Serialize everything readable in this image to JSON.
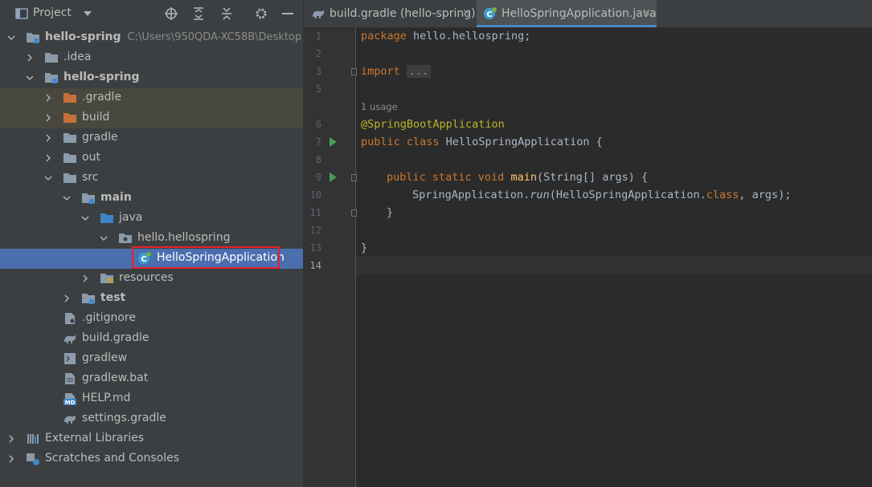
{
  "project_panel": {
    "title": "Project",
    "tree": [
      {
        "label": "hello-spring",
        "path": "C:\\Users\\950QDA-XC58B\\Desktop",
        "expanded": true,
        "bold": true,
        "icon": "module-folder-icon"
      },
      {
        "label": ".idea",
        "expanded": false,
        "icon": "folder-icon"
      },
      {
        "label": "hello-spring",
        "expanded": true,
        "bold": true,
        "icon": "module-folder-icon"
      },
      {
        "label": ".gradle",
        "expanded": false,
        "icon": "excluded-folder-icon"
      },
      {
        "label": "build",
        "expanded": false,
        "icon": "excluded-folder-icon"
      },
      {
        "label": "gradle",
        "expanded": false,
        "icon": "folder-icon"
      },
      {
        "label": "out",
        "expanded": false,
        "icon": "folder-icon"
      },
      {
        "label": "src",
        "expanded": true,
        "icon": "folder-icon"
      },
      {
        "label": "main",
        "expanded": true,
        "bold": true,
        "icon": "source-folder-icon"
      },
      {
        "label": "java",
        "expanded": true,
        "icon": "java-source-root-icon"
      },
      {
        "label": "hello.hellospring",
        "expanded": true,
        "icon": "package-icon"
      },
      {
        "label": "HelloSpringApplication",
        "selected": true,
        "icon": "spring-boot-class-icon"
      },
      {
        "label": "resources",
        "expanded": false,
        "icon": "resources-folder-icon"
      },
      {
        "label": "test",
        "expanded": false,
        "bold": true,
        "icon": "test-folder-icon"
      },
      {
        "label": ".gitignore",
        "icon": "gitignore-file-icon"
      },
      {
        "label": "build.gradle",
        "icon": "gradle-file-icon"
      },
      {
        "label": "gradlew",
        "icon": "shell-file-icon"
      },
      {
        "label": "gradlew.bat",
        "icon": "bat-file-icon"
      },
      {
        "label": "HELP.md",
        "icon": "markdown-file-icon"
      },
      {
        "label": "settings.gradle",
        "icon": "gradle-file-icon"
      },
      {
        "label": "External Libraries",
        "expanded": false,
        "icon": "libraries-icon"
      },
      {
        "label": "Scratches and Consoles",
        "expanded": false,
        "icon": "scratches-icon"
      }
    ]
  },
  "editor": {
    "tabs": [
      {
        "label": "build.gradle (hello-spring)",
        "active": false
      },
      {
        "label": "HelloSpringApplication.java",
        "active": true
      }
    ],
    "usage_hint": "1 usage",
    "code": {
      "l1_kw": "package",
      "l1_rest": " hello.hellospring;",
      "l3_kw": "import",
      "l3_dots": "...",
      "l6": "@SpringBootApplication",
      "l7_kw": "public class",
      "l7_rest": " HelloSpringApplication {",
      "l9_kw": "public static void",
      "l9_fn": "main",
      "l9_rest": "(String[] args) {",
      "l10_a": "SpringApplication.",
      "l10_run": "run",
      "l10_b": "(HelloSpringApplication.",
      "l10_kw": "class",
      "l10_c": ", args);",
      "l11": "}",
      "l13": "}"
    },
    "line_numbers": [
      "1",
      "2",
      "3",
      "5",
      "6",
      "7",
      "8",
      "9",
      "10",
      "11",
      "12",
      "13",
      "14"
    ],
    "current_line": "14"
  },
  "colors": {
    "accent_selection": "#4b6eaf",
    "highlight_box": "#e8202a",
    "keyword": "#cc7832",
    "annotation": "#bbb529",
    "function": "#ffc66d"
  }
}
